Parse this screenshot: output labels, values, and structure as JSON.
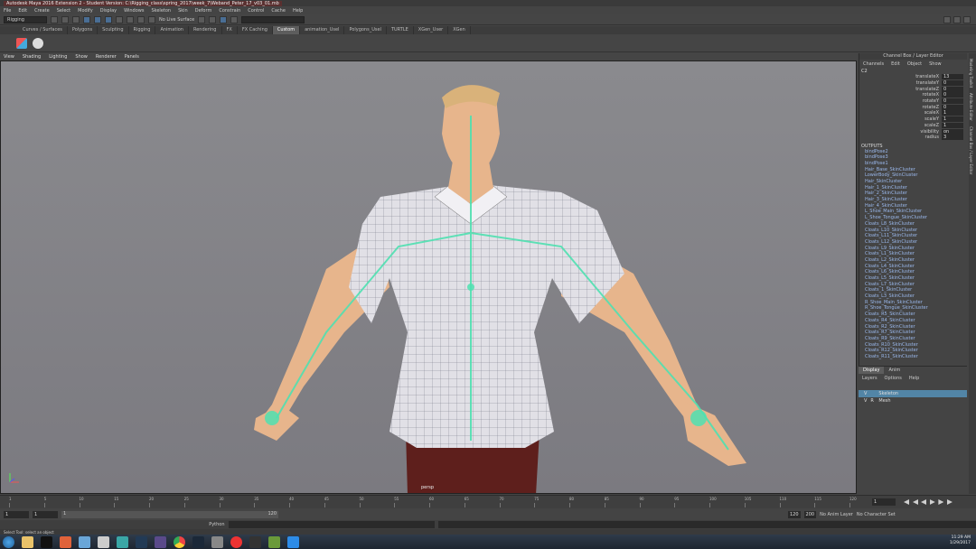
{
  "window": {
    "title": "Autodesk Maya 2016 Extension 2 - Student Version: C:\\Rigging_class\\spring_2017\\week_7\\Weband_Peter_17_v03_01.mb"
  },
  "menubar": [
    "File",
    "Edit",
    "Create",
    "Select",
    "Modify",
    "Display",
    "Windows",
    "Skeleton",
    "Skin",
    "Deform",
    "Constrain",
    "Control",
    "Cache",
    "Help"
  ],
  "statusline": {
    "menuset": "Rigging",
    "live_surface": "No Live Surface"
  },
  "shelf_tabs": [
    {
      "label": "Curves / Surfaces"
    },
    {
      "label": "Polygons"
    },
    {
      "label": "Sculpting"
    },
    {
      "label": "Rigging"
    },
    {
      "label": "Animation"
    },
    {
      "label": "Rendering"
    },
    {
      "label": "FX"
    },
    {
      "label": "FX Caching"
    },
    {
      "label": "Custom",
      "active": true
    },
    {
      "label": "animation_Usel"
    },
    {
      "label": "Polygons_Usel"
    },
    {
      "label": "TURTLE"
    },
    {
      "label": "XGen_User"
    },
    {
      "label": "XGen"
    }
  ],
  "viewport": {
    "menu": [
      "View",
      "Shading",
      "Lighting",
      "Show",
      "Renderer",
      "Panels"
    ],
    "camera": "persp"
  },
  "channelbox": {
    "header": "Channel Box / Layer Editor",
    "tabs": [
      "Channels",
      "Edit",
      "Object",
      "Show"
    ],
    "object": "C2",
    "attributes": [
      {
        "label": "translateX",
        "value": "13"
      },
      {
        "label": "translateY",
        "value": "0"
      },
      {
        "label": "translateZ",
        "value": "0"
      },
      {
        "label": "rotateX",
        "value": "0"
      },
      {
        "label": "rotateY",
        "value": "0"
      },
      {
        "label": "rotateZ",
        "value": "0"
      },
      {
        "label": "scaleX",
        "value": "1"
      },
      {
        "label": "scaleY",
        "value": "1"
      },
      {
        "label": "scaleZ",
        "value": "1"
      },
      {
        "label": "visibility",
        "value": "on"
      },
      {
        "label": "radius",
        "value": "3"
      }
    ],
    "outputs_label": "OUTPUTS",
    "outputs": [
      "bindPose2",
      "bindPose3",
      "bindPose1",
      "Hair_Base_SkinCluster",
      "LowerBody_SkinCluster",
      "Hair_SkinCluster",
      "Hair_1_SkinCluster",
      "Hair_2_SkinCluster",
      "Hair_3_SkinCluster",
      "Hair_4_SkinCluster",
      "L_Shoe_Main_SkinCluster",
      "L_Shoe_Tongue_SkinCluster",
      "Cloats_L8_SkinCluster",
      "Cloats_L10_SkinCluster",
      "Cloats_L11_SkinCluster",
      "Cloats_L12_SkinCluster",
      "Cloats_L9_SkinCluster",
      "Cloats_L1_SkinCluster",
      "Cloats_L2_SkinCluster",
      "Cloats_L4_SkinCluster",
      "Cloats_L6_SkinCluster",
      "Cloats_L5_SkinCluster",
      "Cloats_L7_SkinCluster",
      "Cloats_1_SkinCluster",
      "Cloats_L3_SkinCluster",
      "R_Shoe_Main_SkinCluster",
      "R_Shoe_Tongue_SkinCluster",
      "Cloats_R5_SkinCluster",
      "Cloats_R4_SkinCluster",
      "Cloats_R2_SkinCluster",
      "Cloats_R7_SkinCluster",
      "Cloats_R9_SkinCluster",
      "Cloats_R10_SkinCluster",
      "Cloats_R12_SkinCluster",
      "Cloats_R11_SkinCluster"
    ]
  },
  "layers": {
    "tabs": [
      "Display",
      "Anim"
    ],
    "menu": [
      "Layers",
      "Options",
      "Help"
    ],
    "rows": [
      {
        "v": "V",
        "p": "",
        "name": "Skeleton",
        "selected": true
      },
      {
        "v": "V",
        "p": "R",
        "name": "Mesh",
        "selected": false
      }
    ]
  },
  "side_tabs": [
    "Modeling Toolkit",
    "Attribute Editor",
    "Channel Box / Layer Editor"
  ],
  "timeslider": {
    "ticks": [
      "1",
      "5",
      "10",
      "15",
      "20",
      "25",
      "30",
      "35",
      "40",
      "45",
      "50",
      "55",
      "60",
      "65",
      "70",
      "75",
      "80",
      "85",
      "90",
      "95",
      "100",
      "105",
      "110",
      "115",
      "120"
    ],
    "current_frame": "1"
  },
  "rangeslider": {
    "start": "1",
    "anim_start": "1",
    "range_start": "1",
    "range_end": "120",
    "anim_end": "120",
    "end": "200",
    "anim_layer": "No Anim Layer",
    "character_set": "No Character Set"
  },
  "commandline": {
    "lang": "Python"
  },
  "helpline": "Select Tool: select an object",
  "taskbar": {
    "time": "11:29 AM",
    "date": "1/29/2017"
  },
  "colors": {
    "selection": "#5285a6",
    "joint": "#4fe0b0",
    "shirt": "#e1e0e6",
    "skin": "#e7b58c",
    "pants": "#5e1f1c"
  }
}
